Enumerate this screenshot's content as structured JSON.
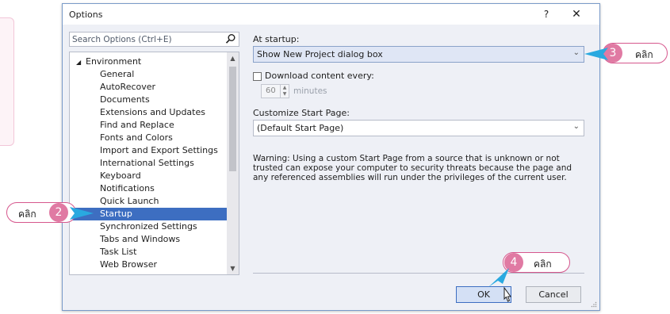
{
  "dialog": {
    "title": "Options",
    "help_label": "?",
    "close_label": "✕"
  },
  "search": {
    "placeholder": "Search Options (Ctrl+E)"
  },
  "tree": {
    "items": [
      {
        "label": "Environment",
        "level": 0,
        "expanded": true
      },
      {
        "label": "General",
        "level": 1
      },
      {
        "label": "AutoRecover",
        "level": 1
      },
      {
        "label": "Documents",
        "level": 1
      },
      {
        "label": "Extensions and Updates",
        "level": 1
      },
      {
        "label": "Find and Replace",
        "level": 1
      },
      {
        "label": "Fonts and Colors",
        "level": 1
      },
      {
        "label": "Import and Export Settings",
        "level": 1
      },
      {
        "label": "International Settings",
        "level": 1
      },
      {
        "label": "Keyboard",
        "level": 1
      },
      {
        "label": "Notifications",
        "level": 1
      },
      {
        "label": "Quick Launch",
        "level": 1
      },
      {
        "label": "Startup",
        "level": 1,
        "selected": true
      },
      {
        "label": "Synchronized Settings",
        "level": 1
      },
      {
        "label": "Tabs and Windows",
        "level": 1
      },
      {
        "label": "Task List",
        "level": 1
      },
      {
        "label": "Web Browser",
        "level": 1
      }
    ]
  },
  "settings": {
    "at_startup_label": "At startup:",
    "at_startup_value": "Show New Project dialog box",
    "download_label": "Download content every:",
    "download_checked": false,
    "interval_value": "60",
    "interval_unit": "minutes",
    "start_page_label": "Customize Start Page:",
    "start_page_value": "(Default Start Page)",
    "warning": "Warning: Using a custom Start Page from a source that is unknown or not trusted can expose your computer to security threats because the page and any referenced assemblies will run under the privileges of the current user."
  },
  "buttons": {
    "ok": "OK",
    "cancel": "Cancel"
  },
  "callouts": [
    {
      "number": "2",
      "text": "คลิก"
    },
    {
      "number": "3",
      "text": "คลิก"
    },
    {
      "number": "4",
      "text": "คลิก"
    }
  ],
  "colors": {
    "accent": "#3d6ec1",
    "callout_pink": "#e07aa3",
    "callout_border": "#d6578d",
    "pointer_blue": "#29a9e0"
  }
}
